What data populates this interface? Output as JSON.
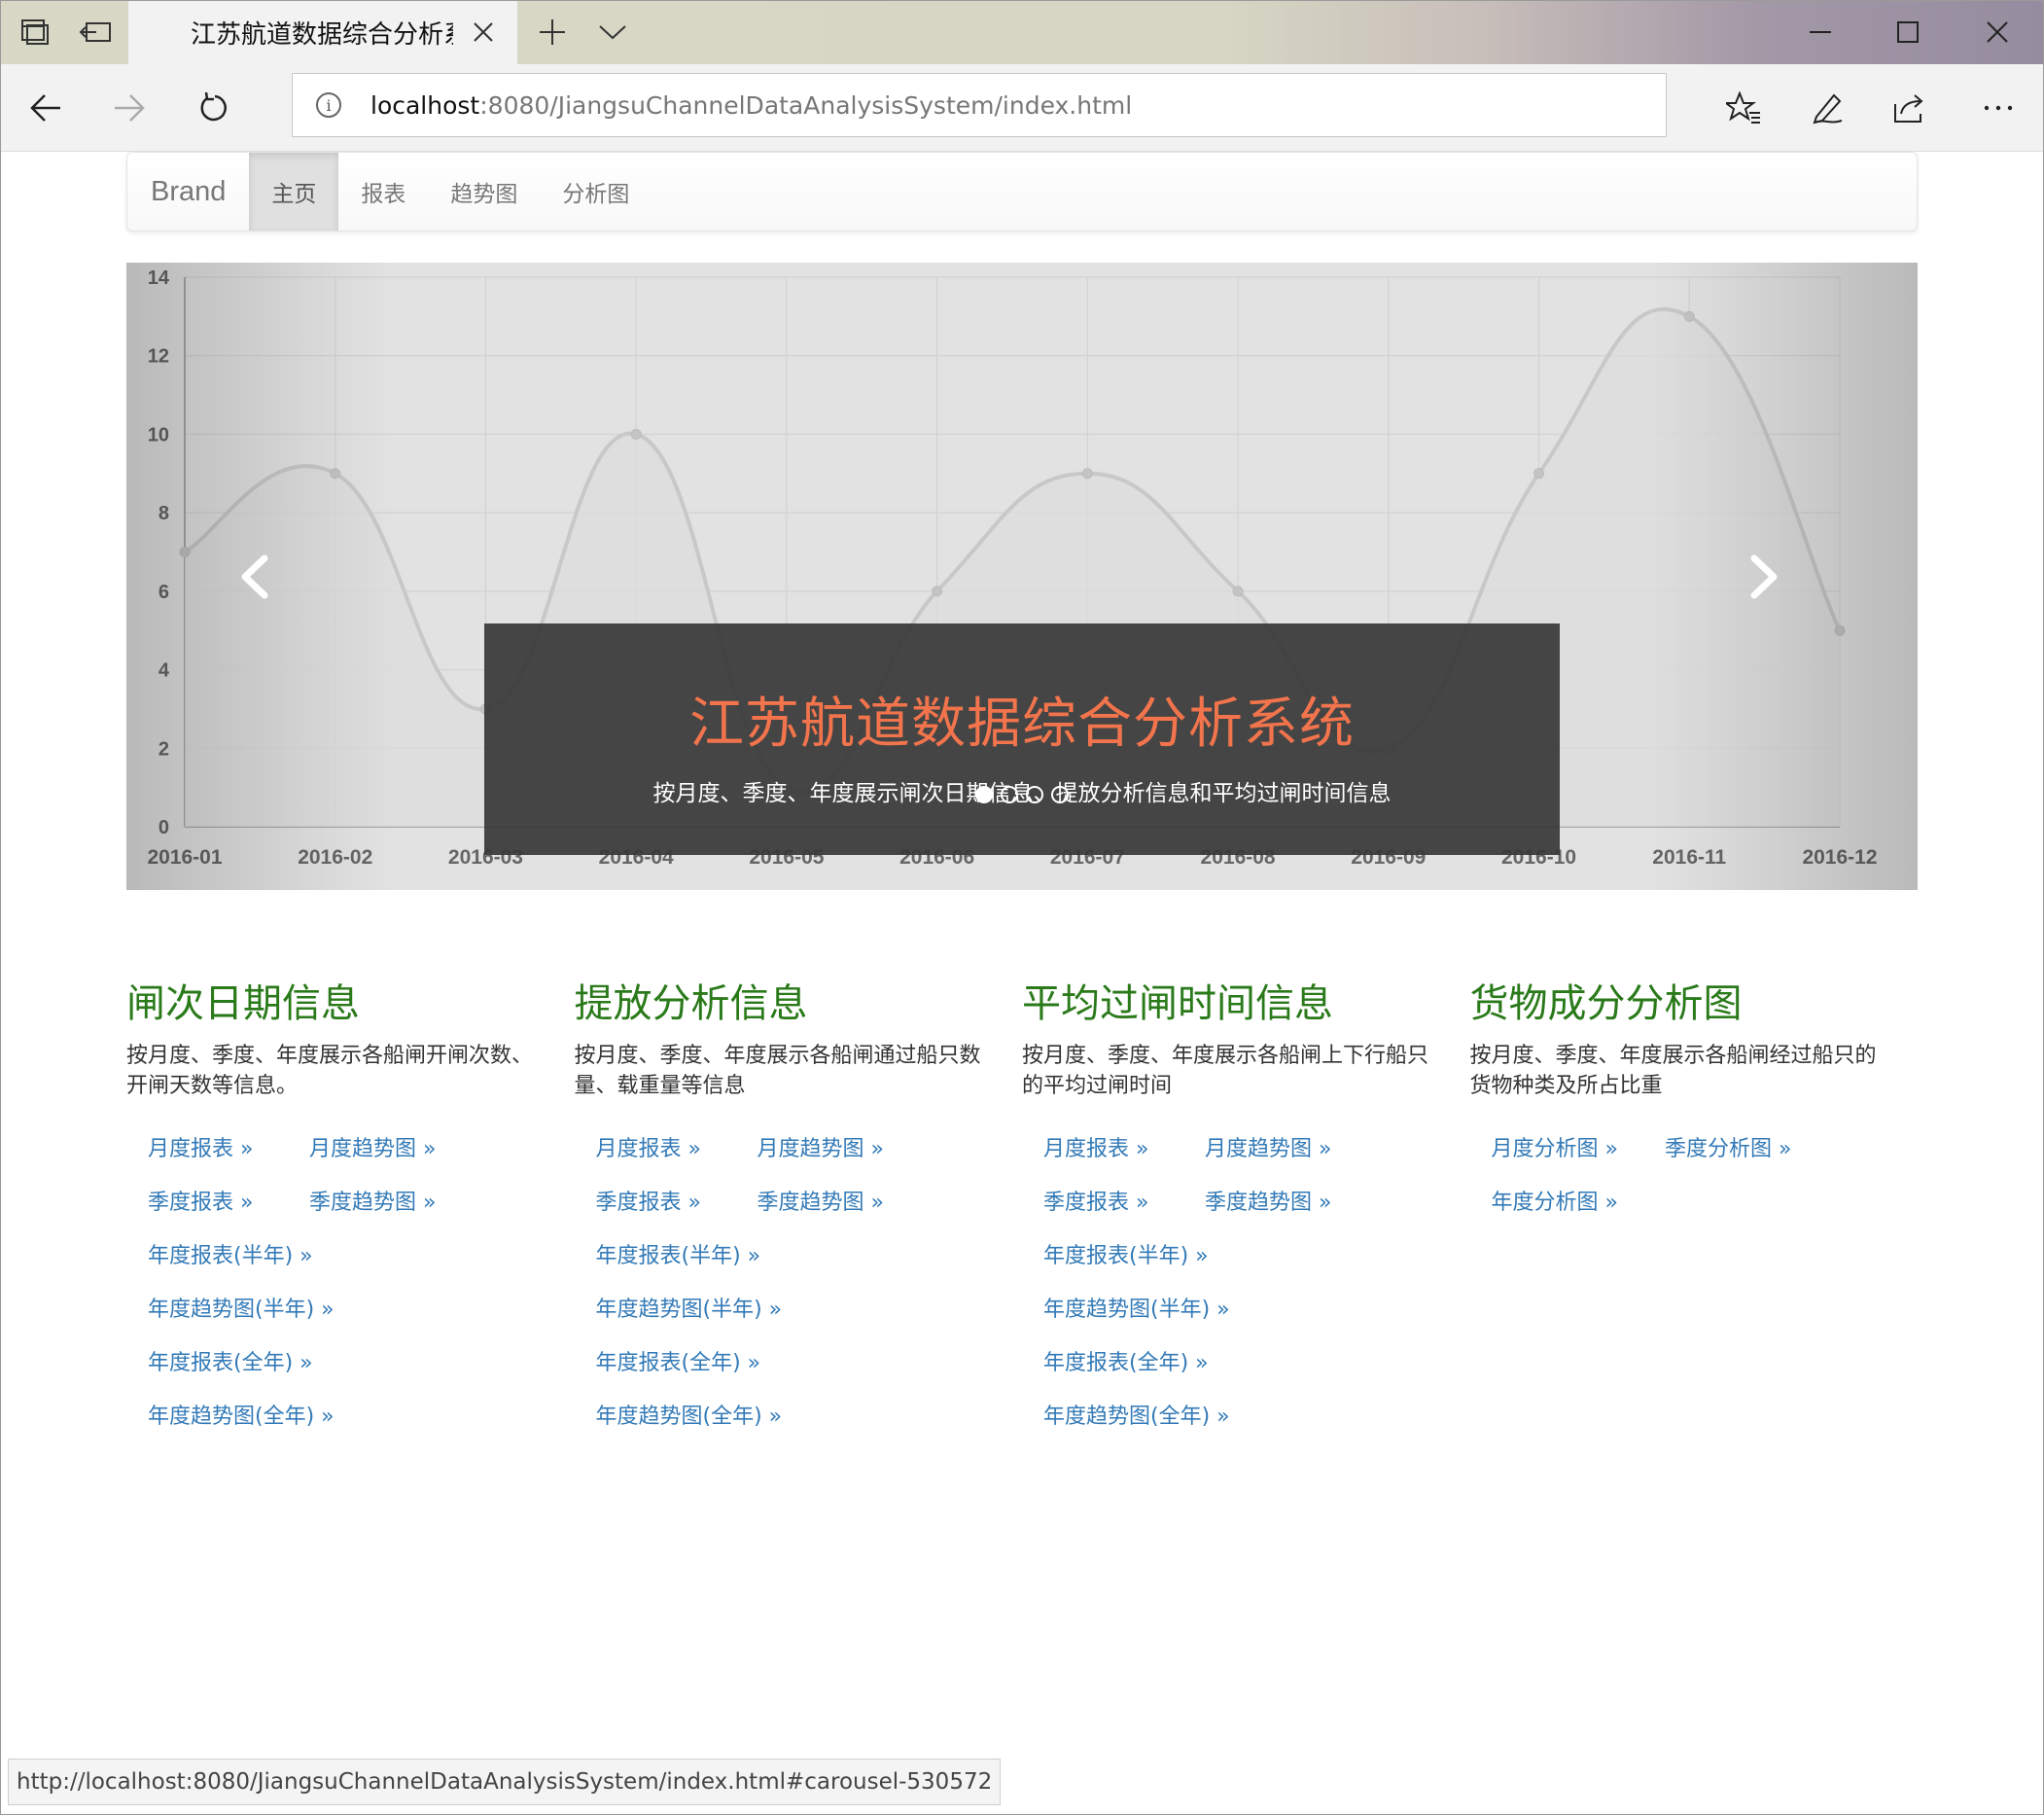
{
  "browser": {
    "tab_title": "江苏航道数据综合分析系",
    "url_host": "localhost",
    "url_rest": ":8080/JiangsuChannelDataAnalysisSystem/index.html",
    "status_url": "http://localhost:8080/JiangsuChannelDataAnalysisSystem/index.html#carousel-530572"
  },
  "nav": {
    "brand": "Brand",
    "items": [
      "主页",
      "报表",
      "趋势图",
      "分析图"
    ]
  },
  "carousel": {
    "title": "江苏航道数据综合分析系统",
    "subtitle": "按月度、季度、年度展示闸次日期信息、提放分析信息和平均过闸时间信息",
    "slides": 4,
    "active_slide": 0
  },
  "chart_data": {
    "type": "area",
    "x": [
      "2016-01",
      "2016-02",
      "2016-03",
      "2016-04",
      "2016-05",
      "2016-06",
      "2016-07",
      "2016-08",
      "2016-09",
      "2016-10",
      "2016-11",
      "2016-12"
    ],
    "values": [
      7,
      9,
      3,
      10,
      1,
      6,
      9,
      6,
      2,
      9,
      13,
      5
    ],
    "ylim": [
      0,
      14
    ],
    "yticks": [
      0,
      2,
      4,
      6,
      8,
      10,
      12,
      14
    ],
    "grid": true,
    "fill_color": "#dcdcdc",
    "line_color": "#c8c8c8"
  },
  "sections": [
    {
      "title": "闸次日期信息",
      "desc": "按月度、季度、年度展示各船闸开闸次数、开闸天数等信息。",
      "links": [
        "月度报表 »",
        "月度趋势图 »",
        "季度报表 »",
        "季度趋势图 »",
        "年度报表(半年) »",
        "年度趋势图(半年) »",
        "年度报表(全年) »",
        "年度趋势图(全年) »"
      ]
    },
    {
      "title": "提放分析信息",
      "desc": "按月度、季度、年度展示各船闸通过船只数量、载重量等信息",
      "links": [
        "月度报表 »",
        "月度趋势图 »",
        "季度报表 »",
        "季度趋势图 »",
        "年度报表(半年) »",
        "年度趋势图(半年) »",
        "年度报表(全年) »",
        "年度趋势图(全年) »"
      ]
    },
    {
      "title": "平均过闸时间信息",
      "desc": "按月度、季度、年度展示各船闸上下行船只的平均过闸时间",
      "links": [
        "月度报表 »",
        "月度趋势图 »",
        "季度报表 »",
        "季度趋势图 »",
        "年度报表(半年) »",
        "年度趋势图(半年) »",
        "年度报表(全年) »",
        "年度趋势图(全年) »"
      ]
    },
    {
      "title": "货物成分分析图",
      "desc": "按月度、季度、年度展示各船闸经过船只的货物种类及所占比重",
      "links": [
        "月度分析图 »",
        "季度分析图 »",
        "年度分析图 »"
      ]
    }
  ],
  "colors": {
    "heading_green": "#2a7a1a",
    "link_blue": "#337ab7",
    "caption_title": "#f2744c"
  }
}
